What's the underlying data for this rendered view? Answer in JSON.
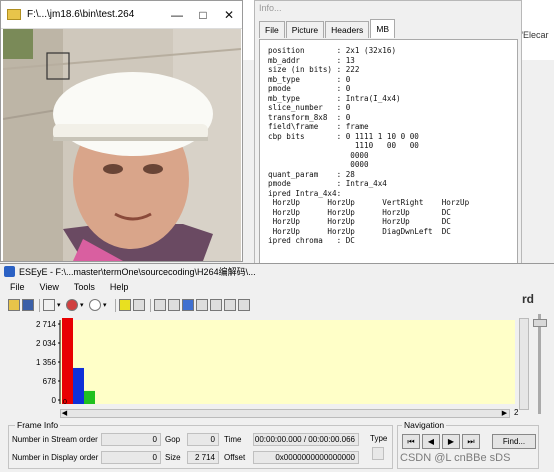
{
  "background_window": {
    "snippet": "“Elecar"
  },
  "video_window": {
    "title": "F:\\...\\jm18.6\\bin\\test.264",
    "minimize": "—",
    "maximize": "□",
    "close": "✕"
  },
  "info_window": {
    "title": "Info...",
    "tabs": [
      "File",
      "Picture",
      "Headers",
      "MB"
    ],
    "active_tab": "MB",
    "mb_lines": [
      "position       : 2x1 (32x16)",
      "mb_addr        : 13",
      "size (in bits) : 222",
      "mb_type        : 0",
      "pmode          : 0",
      "mb_type        : Intra(I_4x4)",
      "slice_number   : 0",
      "transform_8x8  : 0",
      "field\\frame    : frame",
      "cbp bits       : 0 1111 1 10 0 00",
      "                   1110   00   00",
      "                  0000",
      "                  0000",
      "quant_param    : 28",
      "pmode          : Intra_4x4",
      "ipred Intra_4x4:",
      " HorzUp      HorzUp      VertRight    HorzUp",
      " HorzUp      HorzUp      HorzUp       DC",
      " HorzUp      HorzUp      HorzUp       DC",
      " HorzUp      HorzUp      DiagDwnLeft  DC",
      "ipred chroma   : DC"
    ]
  },
  "ese_window": {
    "title": "ESEyE - F:\\...master\\termOne\\sourcecoding\\H264编解码\\...",
    "menu": [
      "File",
      "View",
      "Tools",
      "Help"
    ],
    "right_fragment": "rd"
  },
  "chart_data": {
    "type": "bar",
    "categories": [
      "0",
      "1",
      "2"
    ],
    "values": [
      2714,
      1060,
      300
    ],
    "bar_colors": [
      "#e80000",
      "#1030d8",
      "#20c020"
    ],
    "ytick_labels": [
      "2 714",
      "2 034",
      "1 356",
      "678",
      "0"
    ],
    "ylim": [
      0,
      2714
    ],
    "xlim_label_left": "0",
    "xlim_label_right": "2",
    "plot_background": "#ffffc8"
  },
  "frame_info": {
    "legend": "Frame Info",
    "stream_order_label": "Number in Stream order",
    "stream_order_value": "0",
    "display_order_label": "Number in Display order",
    "display_order_value": "0",
    "gop_label": "Gop",
    "gop_value": "0",
    "size_label": "Size",
    "size_value": "2 714",
    "time_label": "Time",
    "time_value": "00:00:00.000 / 00:00:00.066",
    "offset_label": "Offset",
    "offset_value": "0x0000000000000000",
    "type_label": "Type"
  },
  "navigation": {
    "legend": "Navigation",
    "buttons": [
      "⏮",
      "◀",
      "▶",
      "⏭"
    ],
    "find_label": "Find..."
  },
  "watermark": "CSDN @L   cnBBe  sDS"
}
